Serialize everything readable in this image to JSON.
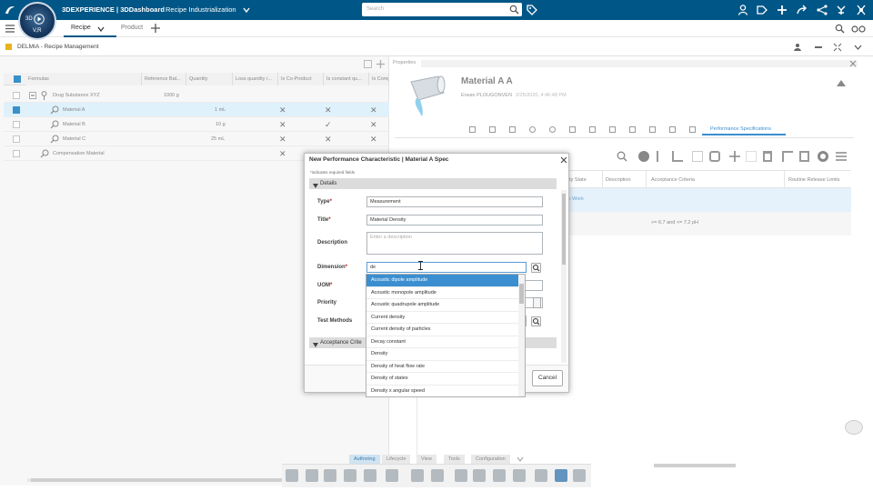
{
  "topbar": {
    "brand": "3DEXPERIENCE | 3DDashboard",
    "dashboard": "Recipe Industrialization",
    "search_placeholder": "Search",
    "compass_labels": [
      "3D",
      "V,R"
    ]
  },
  "tabs": {
    "items": [
      "Recipe",
      "Product"
    ]
  },
  "app": {
    "title": "DELMIA - Recipe Management"
  },
  "grid": {
    "headers": [
      "Formulas",
      "Reference Bat...",
      "Quantity",
      "Loss quantity r...",
      "Is Co-Product",
      "Is constant qu...",
      "Is Comp"
    ],
    "rows": [
      {
        "name": "Drug Substance XYZ",
        "ref": "1000 g",
        "qty": "",
        "co": "",
        "const": "",
        "comp": ""
      },
      {
        "name": "Material A",
        "ref": "",
        "qty": "1 mL",
        "co": "✕",
        "const": "✕",
        "comp": "✕"
      },
      {
        "name": "Material B",
        "ref": "",
        "qty": "10 g",
        "co": "✕",
        "const": "✓",
        "comp": "✕"
      },
      {
        "name": "Material C",
        "ref": "",
        "qty": "25 mL",
        "co": "✕",
        "const": "✕",
        "comp": "✕"
      },
      {
        "name": "Compensation Material",
        "ref": "",
        "qty": "",
        "co": "✕",
        "const": "",
        "comp": ""
      }
    ]
  },
  "properties": {
    "tab_label": "Properties",
    "title": "Material A A",
    "owner": "Erwan PLOUGONVEN",
    "date": "2/25/2020, 4:46:48 PM",
    "active_tab": "Performance Specifications",
    "columns": [
      "urity State",
      "Description",
      "Acceptance Criteria",
      "Routine Release Limits"
    ],
    "row_state": "In Work",
    "row_criteria": ">= 6.7 and <= 7.2   pH"
  },
  "dialog": {
    "title": "New Performance Characteristic | Material A Spec",
    "required_note": "*indicates required fields",
    "section_details": "Details",
    "section_acceptance": "Acceptance Crite",
    "fields": {
      "type_label": "Type",
      "type_value": "Measurement",
      "title_label": "Title",
      "title_value": "Material Density",
      "description_label": "Description",
      "description_placeholder": "Enter a description",
      "dimension_label": "Dimension",
      "dimension_value": "de",
      "uom_label": "UOM",
      "priority_label": "Priority",
      "test_methods_label": "Test Methods"
    },
    "cancel_label": "Cancel"
  },
  "dropdown": {
    "options": [
      "Acoustic dipole amplitude",
      "Acoustic monopole amplitude",
      "Acoustic quadrupole amplitude",
      "Current density",
      "Current density of particles",
      "Decay constant",
      "Density",
      "Density of heat flow rate",
      "Density of states",
      "Density x angular speed"
    ]
  },
  "bottom_tabs": {
    "items": [
      "Authoring",
      "Lifecycle",
      "View",
      "Tools",
      "Configuration"
    ]
  },
  "colors": {
    "topbar": "#005686",
    "accent": "#3b8fd0",
    "required": "#c21b17"
  }
}
